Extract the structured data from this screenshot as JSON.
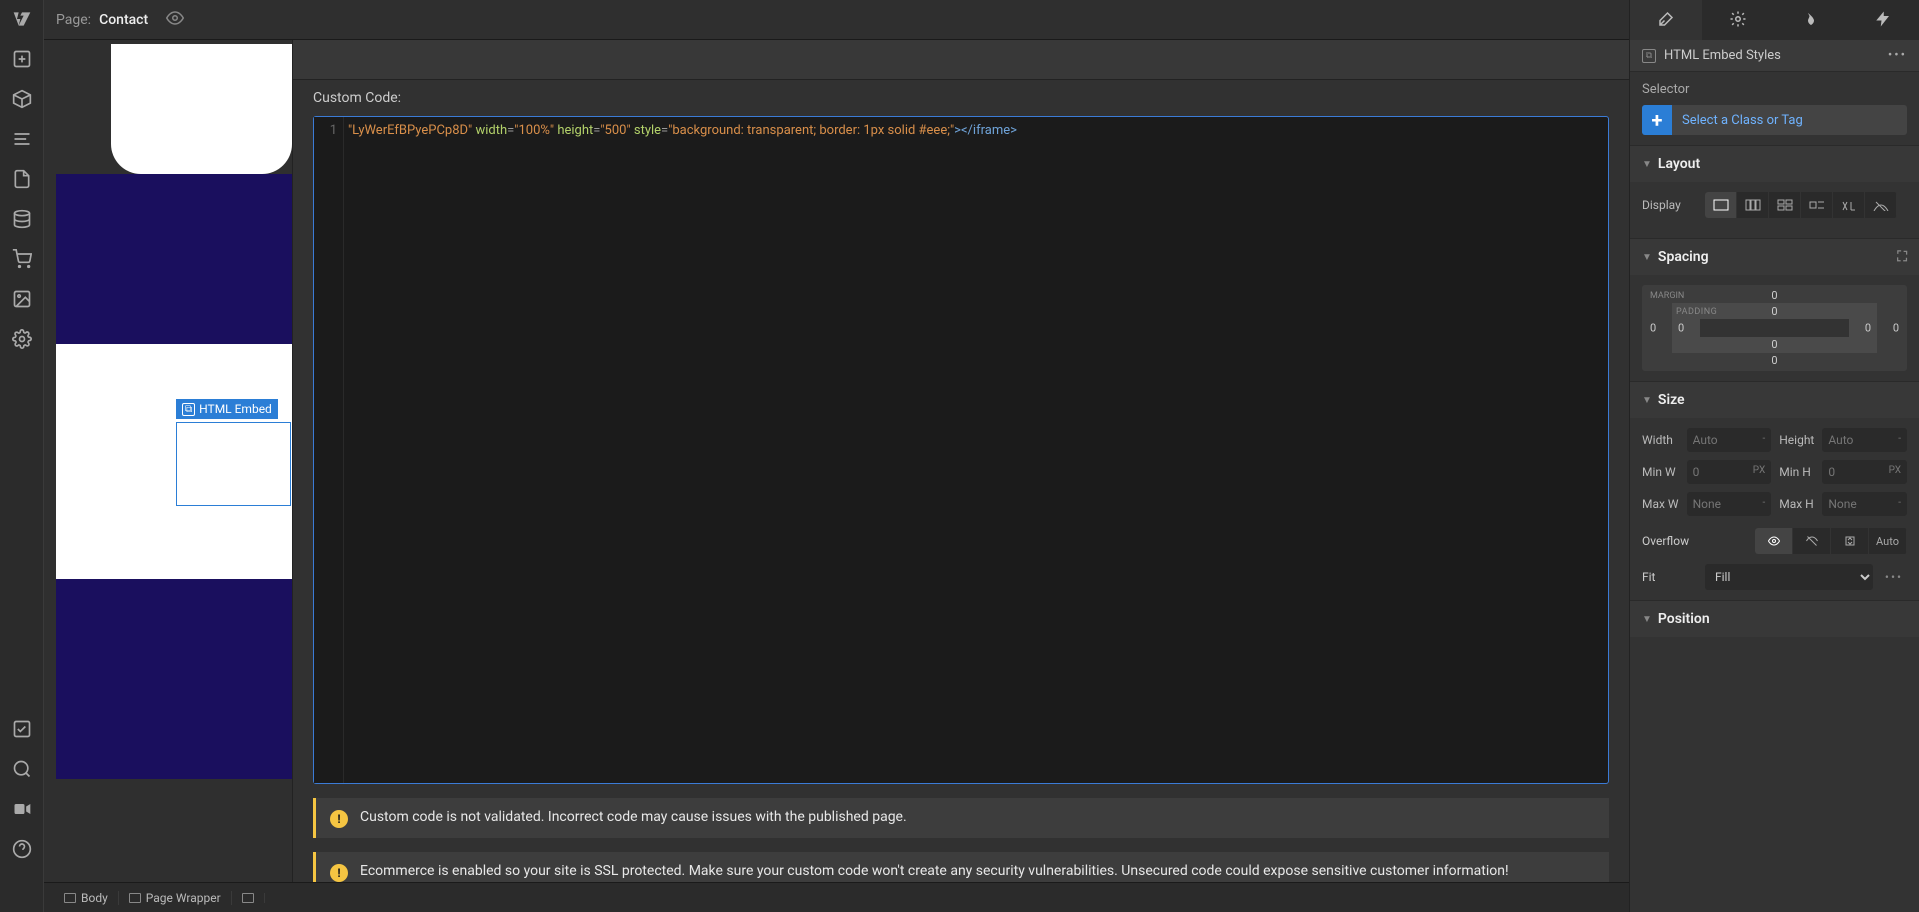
{
  "topbar": {
    "page_label": "Page:",
    "page_name": "Contact"
  },
  "modal": {
    "section_title": "Custom Code:",
    "code_line_no": "1",
    "code_fragment_str1": "\"LyWerEfBPyePCp8D\"",
    "code_attr_width": "width",
    "code_val_width": "\"100%\"",
    "code_attr_height": "height",
    "code_val_height": "\"500\"",
    "code_attr_style": "style",
    "code_val_style": "\"background: transparent; border: 1px solid #eee;\"",
    "code_close_tag": "></iframe>",
    "warning1": "Custom code is not validated. Incorrect code may cause issues with the published page.",
    "warning2": "Ecommerce is enabled so your site is SSL protected. Make sure your custom code won't create any security vulnerabilities. Unsecured code could expose sensitive customer information!"
  },
  "canvas": {
    "embed_label": "HTML Embed"
  },
  "right": {
    "header_label": "HTML Embed Styles",
    "selector_label": "Selector",
    "selector_placeholder": "Select a Class or Tag",
    "layout_label": "Layout",
    "display_label": "Display",
    "spacing_label": "Spacing",
    "margin_label": "MARGIN",
    "padding_label": "PADDING",
    "margin": {
      "top": "0",
      "right": "0",
      "bottom": "0",
      "left": "0"
    },
    "padding": {
      "top": "0",
      "right": "0",
      "bottom": "0",
      "left": "0"
    },
    "size_label": "Size",
    "width_label": "Width",
    "width_val": "Auto",
    "width_unit": "-",
    "height_label": "Height",
    "height_val": "Auto",
    "height_unit": "-",
    "minw_label": "Min W",
    "minw_val": "0",
    "minw_unit": "PX",
    "minh_label": "Min H",
    "minh_val": "0",
    "minh_unit": "PX",
    "maxw_label": "Max W",
    "maxw_val": "None",
    "maxw_unit": "-",
    "maxh_label": "Max H",
    "maxh_val": "None",
    "maxh_unit": "-",
    "overflow_label": "Overflow",
    "overflow_auto": "Auto",
    "fit_label": "Fit",
    "fit_val": "Fill",
    "position_label": "Position"
  },
  "breadcrumbs": {
    "b1": "Body",
    "b2": "Page Wrapper"
  }
}
